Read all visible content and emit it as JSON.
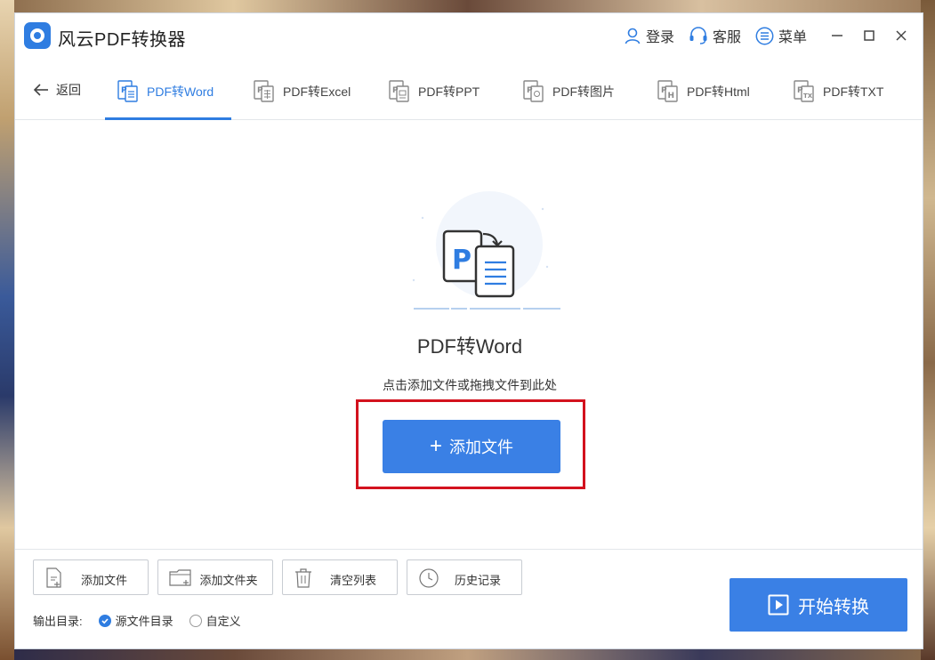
{
  "app": {
    "title": "风云PDF转换器"
  },
  "titlebar": {
    "login": "登录",
    "service": "客服",
    "menu": "菜单"
  },
  "nav": {
    "back": "返回",
    "tabs": [
      {
        "label": "PDF转Word",
        "icon": "pdf-word-icon",
        "active": true
      },
      {
        "label": "PDF转Excel",
        "icon": "pdf-excel-icon",
        "active": false
      },
      {
        "label": "PDF转PPT",
        "icon": "pdf-ppt-icon",
        "active": false
      },
      {
        "label": "PDF转图片",
        "icon": "pdf-image-icon",
        "active": false
      },
      {
        "label": "PDF转Html",
        "icon": "pdf-html-icon",
        "active": false
      },
      {
        "label": "PDF转TXT",
        "icon": "pdf-txt-icon",
        "active": false
      }
    ]
  },
  "main": {
    "title": "PDF转Word",
    "hint": "点击添加文件或拖拽文件到此处",
    "add_button": "添加文件",
    "illustration_letter": "P"
  },
  "bottom": {
    "buttons": [
      {
        "label": "添加文件",
        "icon": "add-file-icon"
      },
      {
        "label": "添加文件夹",
        "icon": "add-folder-icon"
      },
      {
        "label": "清空列表",
        "icon": "trash-icon"
      },
      {
        "label": "历史记录",
        "icon": "clock-icon"
      }
    ],
    "output_label": "输出目录:",
    "options": [
      {
        "label": "源文件目录",
        "selected": true
      },
      {
        "label": "自定义",
        "selected": false
      }
    ],
    "start_button": "开始转换"
  },
  "colors": {
    "accent": "#2f7de1",
    "highlight_box": "#d3121e"
  }
}
